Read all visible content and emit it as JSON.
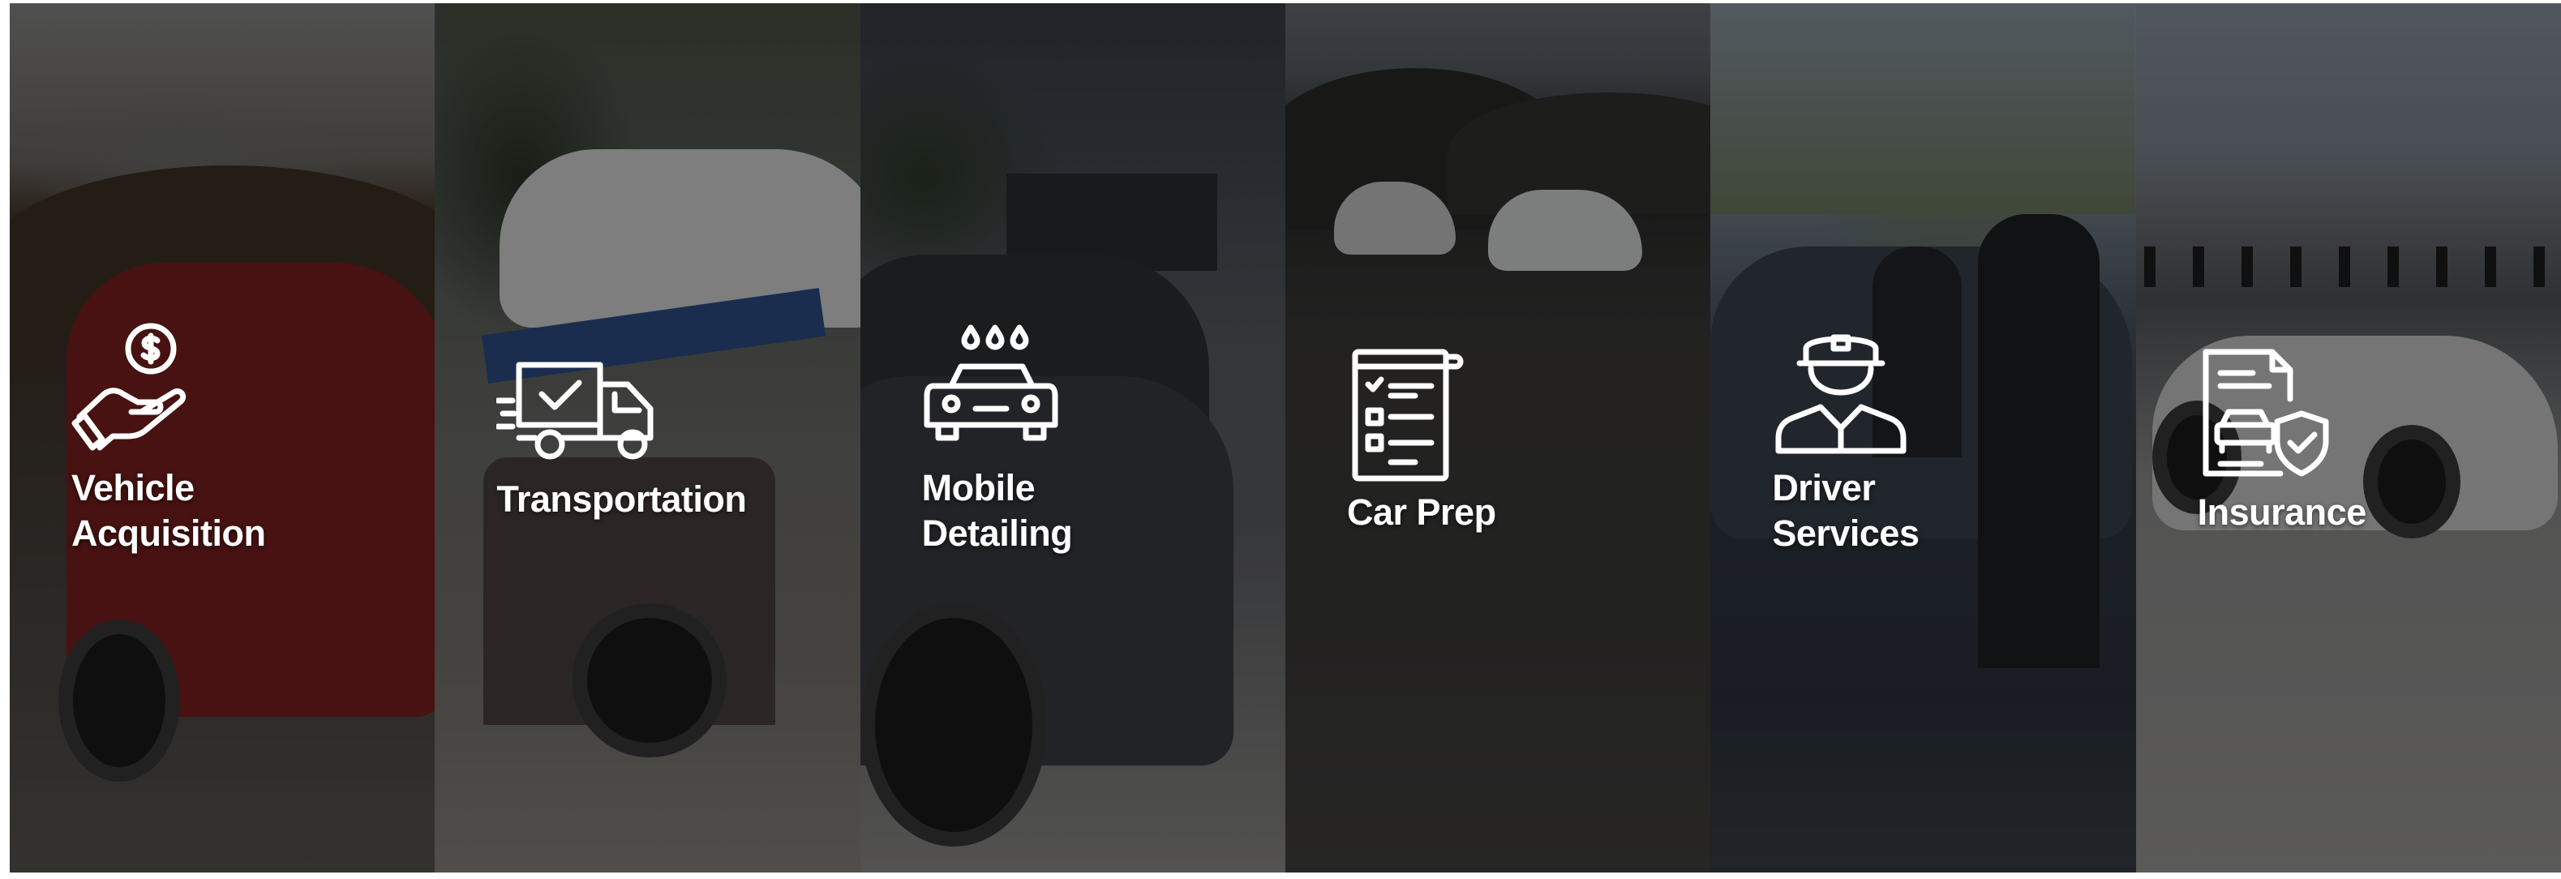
{
  "services": [
    {
      "label": "Vehicle\nAcquisition",
      "icon": "hand-dollar-coin-icon"
    },
    {
      "label": "Transportation",
      "icon": "delivery-truck-check-icon"
    },
    {
      "label": "Mobile\nDetailing",
      "icon": "car-wash-droplets-icon"
    },
    {
      "label": "Car Prep",
      "icon": "checklist-clipboard-icon"
    },
    {
      "label": "Driver\nServices",
      "icon": "chauffeur-driver-icon"
    },
    {
      "label": "Insurance",
      "icon": "insurance-document-car-shield-icon"
    }
  ],
  "colors": {
    "label_text": "#ffffff",
    "icon_stroke": "#ffffff",
    "panel_overlay": "rgba(0,0,0,0.42)"
  }
}
